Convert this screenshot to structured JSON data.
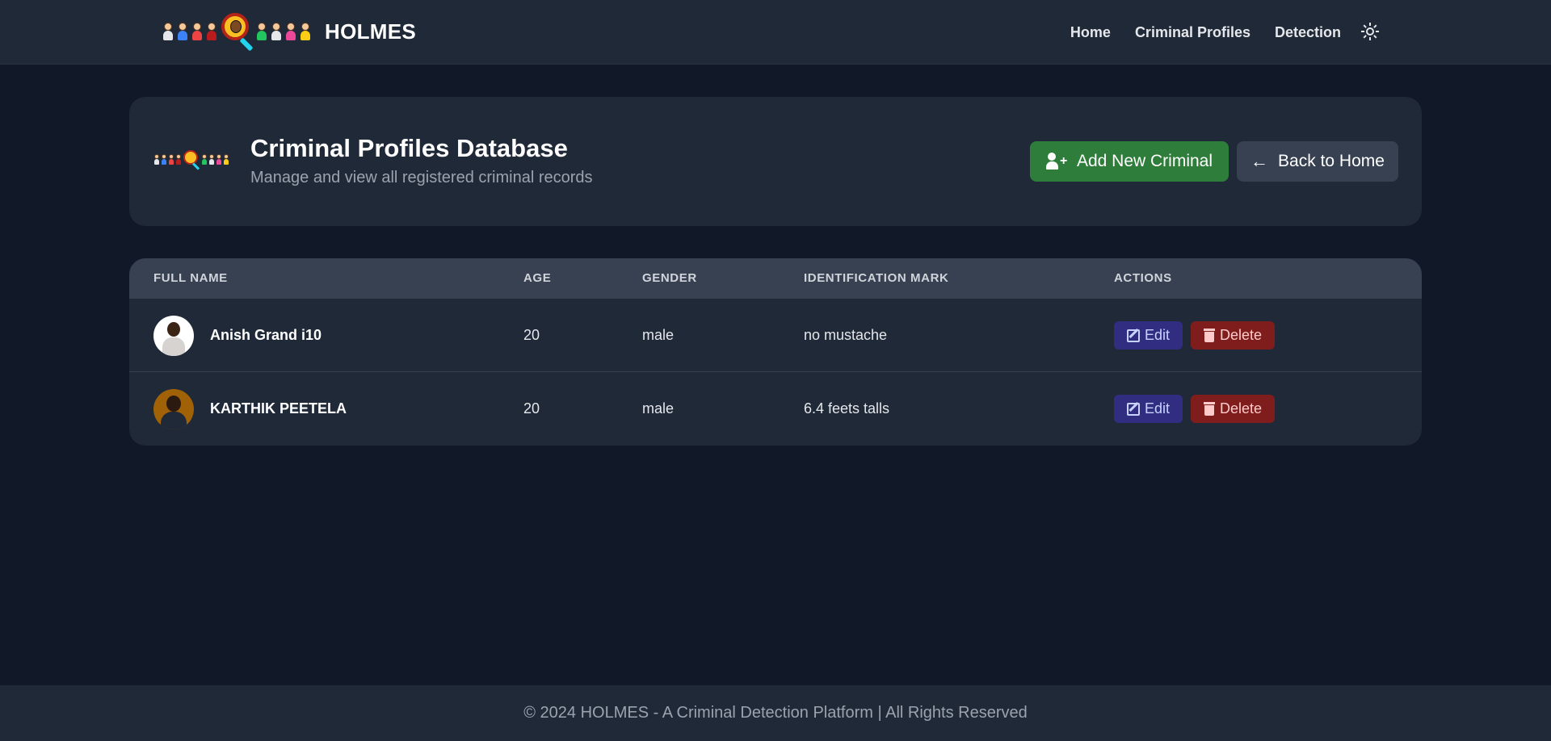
{
  "navbar": {
    "brand": "HOLMES",
    "links": [
      "Home",
      "Criminal Profiles",
      "Detection"
    ],
    "theme_icon": "sun-icon"
  },
  "header": {
    "title": "Criminal Profiles Database",
    "subtitle": "Manage and view all registered criminal records",
    "add_button": "Add New Criminal",
    "back_button": "Back to Home"
  },
  "table": {
    "columns": [
      "FULL NAME",
      "AGE",
      "GENDER",
      "IDENTIFICATION MARK",
      "ACTIONS"
    ],
    "rows": [
      {
        "name": "Anish Grand i10",
        "age": "20",
        "gender": "male",
        "mark": "no mustache",
        "edit": "Edit",
        "delete": "Delete"
      },
      {
        "name": "KARTHIK PEETELA",
        "age": "20",
        "gender": "male",
        "mark": "6.4 feets talls",
        "edit": "Edit",
        "delete": "Delete"
      }
    ]
  },
  "footer": {
    "text": "© 2024 HOLMES - A Criminal Detection Platform | All Rights Reserved"
  },
  "colors": {
    "background": "#111827",
    "surface": "#1f2937",
    "add_button": "#2e7d3a",
    "edit_button": "#312e81",
    "delete_button": "#7f1d1d"
  }
}
